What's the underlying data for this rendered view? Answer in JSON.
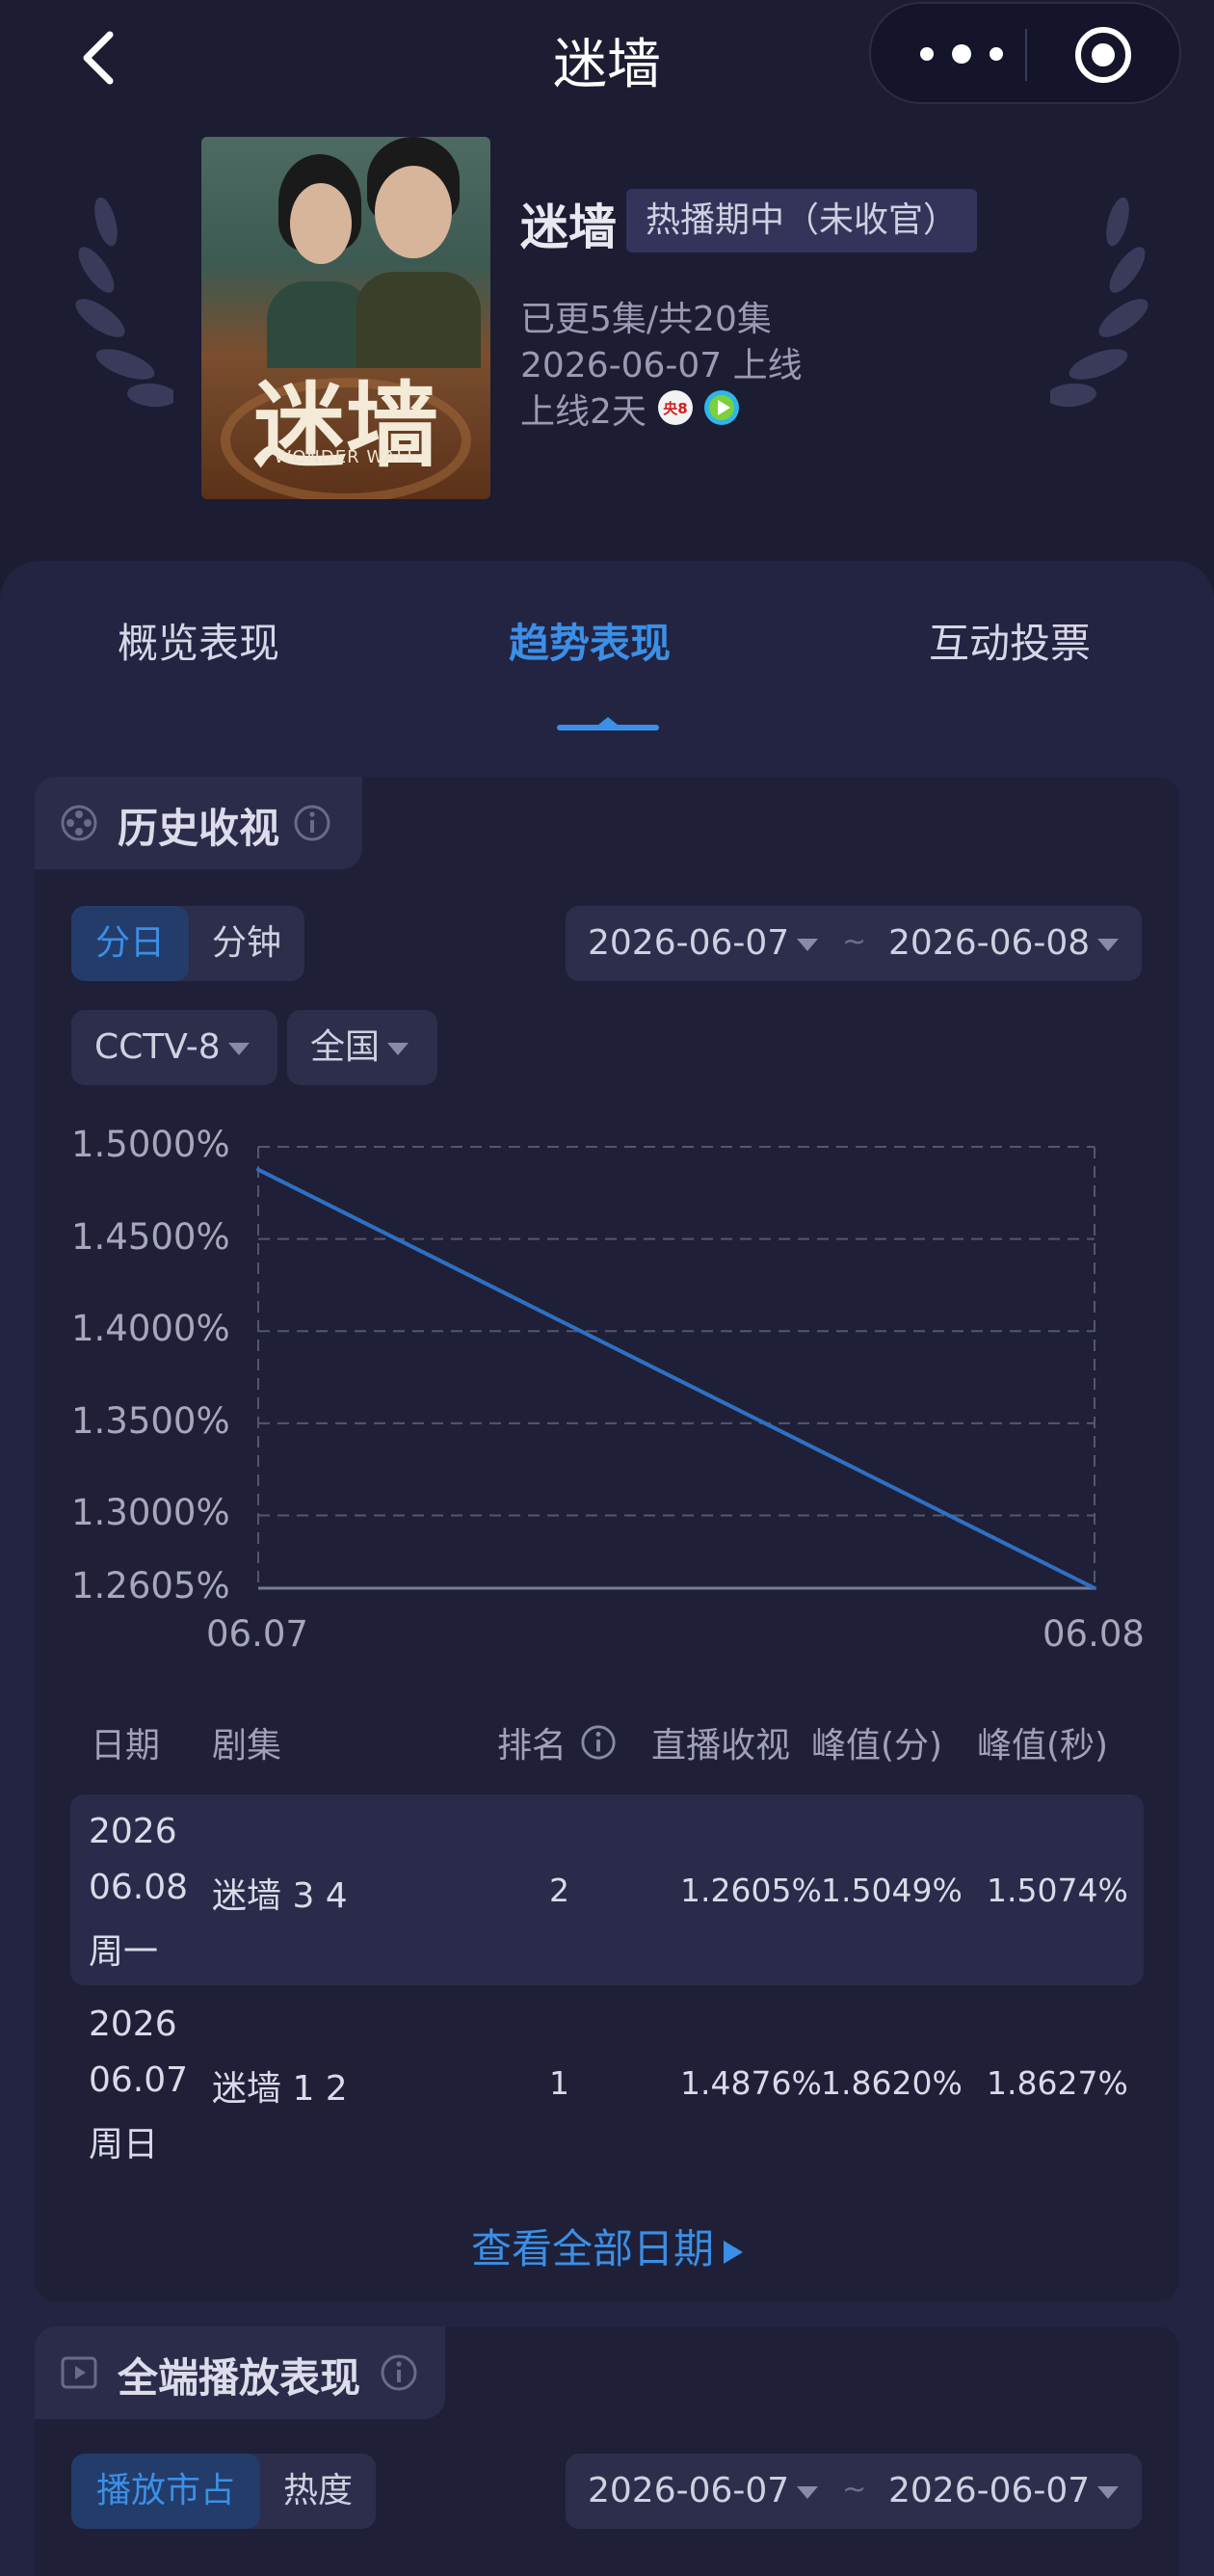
{
  "nav": {
    "title": "迷墙",
    "back_icon": "chevron-left-icon",
    "more_icon": "more-dots-icon",
    "close_icon": "target-circle-icon"
  },
  "drama": {
    "name": "迷墙",
    "status": "热播期中（未收官）",
    "episodes": "已更5集/共20集",
    "premiere": "2026-06-07 上线",
    "days_online": "上线2天",
    "poster_title": "迷墙",
    "poster_subtitle": "WONDER WALL",
    "channel_badges": [
      "cctv8-icon",
      "streaming-play-icon"
    ]
  },
  "tabs": [
    {
      "label": "概览表现",
      "active": false
    },
    {
      "label": "趋势表现",
      "active": true
    },
    {
      "label": "互动投票",
      "active": false
    }
  ],
  "history": {
    "title": "历史收视",
    "granularity": {
      "options": [
        "分日",
        "分钟"
      ],
      "selected": "分日"
    },
    "date_start": "2026-06-07",
    "date_sep": "~",
    "date_end": "2026-06-08",
    "channel": "CCTV-8",
    "region": "全国"
  },
  "chart_data": {
    "type": "line",
    "title": "",
    "xlabel": "",
    "ylabel": "",
    "x": [
      "06.07",
      "06.08"
    ],
    "series": [
      {
        "values": [
          1.4876,
          1.2605
        ]
      }
    ],
    "y_tick_labels": [
      "1.5000%",
      "1.4500%",
      "1.4000%",
      "1.3500%",
      "1.3000%",
      "1.2605%"
    ],
    "y_ticks": [
      1.5,
      1.45,
      1.4,
      1.35,
      1.3,
      1.2605
    ],
    "ylim": [
      1.2605,
      1.5
    ],
    "grid": true,
    "line_color": "#2f6fc6"
  },
  "table": {
    "headers": [
      "日期",
      "剧集",
      "排名",
      "直播收视",
      "峰值(分)",
      "峰值(秒)"
    ],
    "rows": [
      {
        "year": "2026",
        "date": "06.08",
        "weekday": "周一",
        "episode": "迷墙 3 4",
        "rank": "2",
        "live": "1.2605%",
        "peak_min": "1.5049%",
        "peak_sec": "1.5074%"
      },
      {
        "year": "2026",
        "date": "06.07",
        "weekday": "周日",
        "episode": "迷墙 1 2",
        "rank": "1",
        "live": "1.4876%",
        "peak_min": "1.8620%",
        "peak_sec": "1.8627%"
      }
    ],
    "view_all": "查看全部日期"
  },
  "playback": {
    "title": "全端播放表现",
    "options": [
      "播放市占",
      "热度"
    ],
    "selected": "播放市占",
    "date_start": "2026-06-07",
    "date_sep": "~",
    "date_end": "2026-06-07"
  },
  "colors": {
    "accent": "#3b8fe6",
    "background": "#1c1c33",
    "panel": "#232442"
  }
}
